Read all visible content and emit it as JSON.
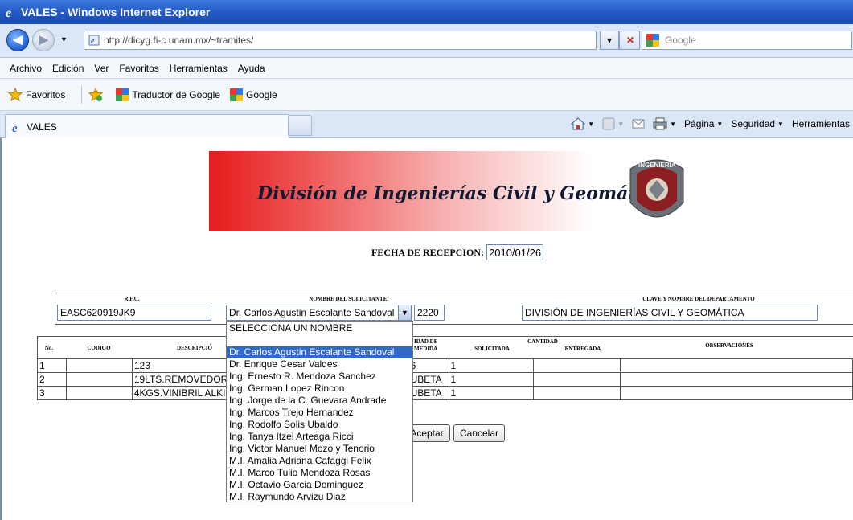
{
  "window": {
    "title": "VALES - Windows Internet Explorer"
  },
  "address": {
    "url": "http://dicyg.fi-c.unam.mx/~tramites/",
    "search_placeholder": "Google"
  },
  "menu": [
    "Archivo",
    "Edición",
    "Ver",
    "Favoritos",
    "Herramientas",
    "Ayuda"
  ],
  "favorites": {
    "label": "Favoritos",
    "items": [
      "Traductor de Google",
      "Google"
    ]
  },
  "tab": {
    "label": "VALES"
  },
  "commands": [
    "Página",
    "Seguridad",
    "Herramientas"
  ],
  "page": {
    "banner_text": "División de Ingenierías Civil y Geomática",
    "seal_text": "INGENIERIA",
    "fecha_label": "FECHA DE RECEPCION:",
    "fecha_value": "2010/01/26",
    "rfc_label": "R.F.C.",
    "rfc_value": "EASC620919JK9",
    "solicitante_label": "NOMBRE DEL SOLICITANTE:",
    "solicitante_value": "Dr. Carlos Agustin Escalante Sandoval",
    "clave_value": "2220",
    "depto_label": "CLAVE Y NOMBRE DEL DEPARTAMENTO",
    "depto_value": "DIVISIÓN DE INGENIERÍAS CIVIL Y GEOMÁTICA",
    "table_headers": {
      "no": "No.",
      "codigo": "CODIGO",
      "descripcion": "DESCRIPCIÓ",
      "unidad": "IDAD DE",
      "medida": "MEDIDA",
      "cantidad": "CANTIDAD",
      "solicitada": "SOLICITADA",
      "entregada": "ENTREGADA",
      "observaciones": "OBSERVACIONES"
    },
    "rows": [
      {
        "no": "1",
        "desc": "123",
        "unidad": "6",
        "solicitada": "1"
      },
      {
        "no": "2",
        "desc": "19LTS.REMOVEDOR",
        "unidad": "UBETA",
        "solicitada": "1"
      },
      {
        "no": "3",
        "desc": "4KGS.VINIBRIL ALKI",
        "unidad": "UBETA",
        "solicitada": "1"
      }
    ],
    "accept_label": "Aceptar",
    "cancel_label": "Cancelar",
    "dropdown_options": [
      "SELECCIONA UN NOMBRE",
      "",
      "Dr. Carlos Agustin Escalante Sandoval",
      "Dr. Enrique Cesar Valdes",
      "Ing. Ernesto R. Mendoza Sanchez",
      "Ing. German Lopez Rincon",
      "Ing. Jorge de la C. Guevara Andrade",
      "Ing. Marcos Trejo Hernandez",
      "Ing. Rodolfo Solis Ubaldo",
      "Ing. Tanya Itzel Arteaga Ricci",
      "Ing. Victor Manuel Mozo y Tenorio",
      "M.I. Amalia Adriana Cafaggi Felix",
      "M.I. Marco Tulio Mendoza Rosas",
      "M.I. Octavio Garcia Dominguez",
      "M.I. Raymundo Arvizu Diaz"
    ],
    "dropdown_selected_index": 2
  }
}
